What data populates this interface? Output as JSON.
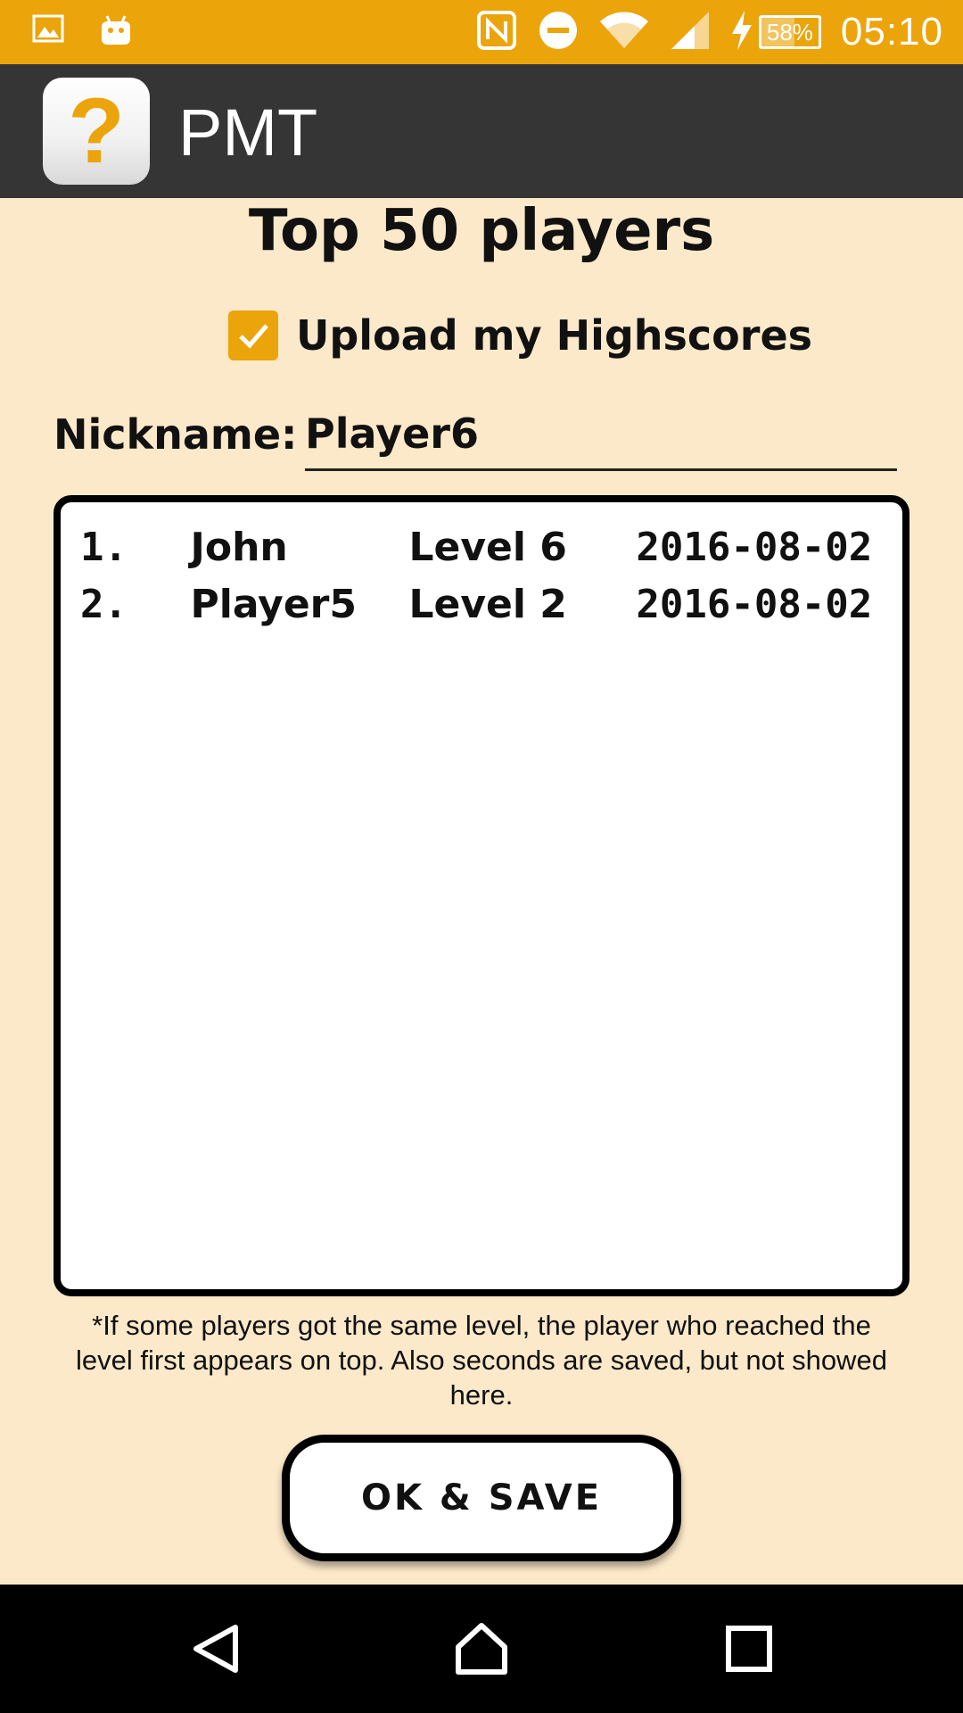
{
  "status_bar": {
    "battery_percent": "58%",
    "battery_level": 0.58,
    "time": "05:10",
    "icons": [
      "image-icon",
      "android-icon",
      "nfc-icon",
      "do-not-disturb-icon",
      "wifi-icon",
      "signal-icon",
      "charging-icon"
    ]
  },
  "app_bar": {
    "icon_glyph": "?",
    "title": "PMT"
  },
  "page": {
    "title": "Top 50 players",
    "upload_label": "Upload my Highscores",
    "upload_checked": true,
    "nickname_label": "Nickname:",
    "nickname_value": "Player6"
  },
  "highscores": [
    {
      "rank": "1.",
      "name": "John",
      "level": "Level 6",
      "date": "2016-08-02"
    },
    {
      "rank": "2.",
      "name": "Player5",
      "level": "Level 2",
      "date": "2016-08-02"
    }
  ],
  "footnote": "*If some players got the same level, the player who reached the level first appears on top. Also seconds are saved, but not showed here.",
  "ok_button_label": "OK & SAVE",
  "colors": {
    "accent": "#eba40a",
    "app_bar": "#353535",
    "background": "#fce9c9"
  }
}
